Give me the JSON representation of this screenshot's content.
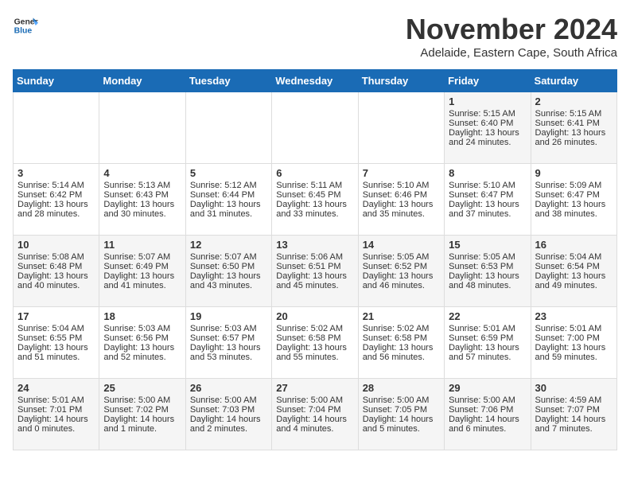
{
  "header": {
    "logo_general": "General",
    "logo_blue": "Blue",
    "month_title": "November 2024",
    "location": "Adelaide, Eastern Cape, South Africa"
  },
  "weekdays": [
    "Sunday",
    "Monday",
    "Tuesday",
    "Wednesday",
    "Thursday",
    "Friday",
    "Saturday"
  ],
  "weeks": [
    [
      {
        "day": "",
        "content": ""
      },
      {
        "day": "",
        "content": ""
      },
      {
        "day": "",
        "content": ""
      },
      {
        "day": "",
        "content": ""
      },
      {
        "day": "",
        "content": ""
      },
      {
        "day": "1",
        "content": "Sunrise: 5:15 AM\nSunset: 6:40 PM\nDaylight: 13 hours\nand 24 minutes."
      },
      {
        "day": "2",
        "content": "Sunrise: 5:15 AM\nSunset: 6:41 PM\nDaylight: 13 hours\nand 26 minutes."
      }
    ],
    [
      {
        "day": "3",
        "content": "Sunrise: 5:14 AM\nSunset: 6:42 PM\nDaylight: 13 hours\nand 28 minutes."
      },
      {
        "day": "4",
        "content": "Sunrise: 5:13 AM\nSunset: 6:43 PM\nDaylight: 13 hours\nand 30 minutes."
      },
      {
        "day": "5",
        "content": "Sunrise: 5:12 AM\nSunset: 6:44 PM\nDaylight: 13 hours\nand 31 minutes."
      },
      {
        "day": "6",
        "content": "Sunrise: 5:11 AM\nSunset: 6:45 PM\nDaylight: 13 hours\nand 33 minutes."
      },
      {
        "day": "7",
        "content": "Sunrise: 5:10 AM\nSunset: 6:46 PM\nDaylight: 13 hours\nand 35 minutes."
      },
      {
        "day": "8",
        "content": "Sunrise: 5:10 AM\nSunset: 6:47 PM\nDaylight: 13 hours\nand 37 minutes."
      },
      {
        "day": "9",
        "content": "Sunrise: 5:09 AM\nSunset: 6:47 PM\nDaylight: 13 hours\nand 38 minutes."
      }
    ],
    [
      {
        "day": "10",
        "content": "Sunrise: 5:08 AM\nSunset: 6:48 PM\nDaylight: 13 hours\nand 40 minutes."
      },
      {
        "day": "11",
        "content": "Sunrise: 5:07 AM\nSunset: 6:49 PM\nDaylight: 13 hours\nand 41 minutes."
      },
      {
        "day": "12",
        "content": "Sunrise: 5:07 AM\nSunset: 6:50 PM\nDaylight: 13 hours\nand 43 minutes."
      },
      {
        "day": "13",
        "content": "Sunrise: 5:06 AM\nSunset: 6:51 PM\nDaylight: 13 hours\nand 45 minutes."
      },
      {
        "day": "14",
        "content": "Sunrise: 5:05 AM\nSunset: 6:52 PM\nDaylight: 13 hours\nand 46 minutes."
      },
      {
        "day": "15",
        "content": "Sunrise: 5:05 AM\nSunset: 6:53 PM\nDaylight: 13 hours\nand 48 minutes."
      },
      {
        "day": "16",
        "content": "Sunrise: 5:04 AM\nSunset: 6:54 PM\nDaylight: 13 hours\nand 49 minutes."
      }
    ],
    [
      {
        "day": "17",
        "content": "Sunrise: 5:04 AM\nSunset: 6:55 PM\nDaylight: 13 hours\nand 51 minutes."
      },
      {
        "day": "18",
        "content": "Sunrise: 5:03 AM\nSunset: 6:56 PM\nDaylight: 13 hours\nand 52 minutes."
      },
      {
        "day": "19",
        "content": "Sunrise: 5:03 AM\nSunset: 6:57 PM\nDaylight: 13 hours\nand 53 minutes."
      },
      {
        "day": "20",
        "content": "Sunrise: 5:02 AM\nSunset: 6:58 PM\nDaylight: 13 hours\nand 55 minutes."
      },
      {
        "day": "21",
        "content": "Sunrise: 5:02 AM\nSunset: 6:58 PM\nDaylight: 13 hours\nand 56 minutes."
      },
      {
        "day": "22",
        "content": "Sunrise: 5:01 AM\nSunset: 6:59 PM\nDaylight: 13 hours\nand 57 minutes."
      },
      {
        "day": "23",
        "content": "Sunrise: 5:01 AM\nSunset: 7:00 PM\nDaylight: 13 hours\nand 59 minutes."
      }
    ],
    [
      {
        "day": "24",
        "content": "Sunrise: 5:01 AM\nSunset: 7:01 PM\nDaylight: 14 hours\nand 0 minutes."
      },
      {
        "day": "25",
        "content": "Sunrise: 5:00 AM\nSunset: 7:02 PM\nDaylight: 14 hours\nand 1 minute."
      },
      {
        "day": "26",
        "content": "Sunrise: 5:00 AM\nSunset: 7:03 PM\nDaylight: 14 hours\nand 2 minutes."
      },
      {
        "day": "27",
        "content": "Sunrise: 5:00 AM\nSunset: 7:04 PM\nDaylight: 14 hours\nand 4 minutes."
      },
      {
        "day": "28",
        "content": "Sunrise: 5:00 AM\nSunset: 7:05 PM\nDaylight: 14 hours\nand 5 minutes."
      },
      {
        "day": "29",
        "content": "Sunrise: 5:00 AM\nSunset: 7:06 PM\nDaylight: 14 hours\nand 6 minutes."
      },
      {
        "day": "30",
        "content": "Sunrise: 4:59 AM\nSunset: 7:07 PM\nDaylight: 14 hours\nand 7 minutes."
      }
    ]
  ]
}
